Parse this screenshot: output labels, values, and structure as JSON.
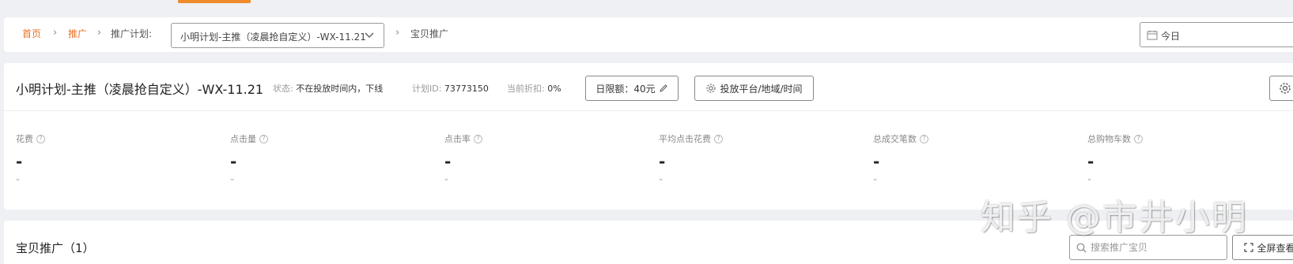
{
  "breadcrumb": {
    "home": "首页",
    "promote": "推广",
    "plan_label": "推广计划:",
    "plan_select_value": "小明计划-主推（凌晨抢自定义）-WX-11.21",
    "current": "宝贝推广"
  },
  "date_filter": {
    "value": "今日"
  },
  "plan": {
    "title": "小明计划-主推（凌晨抢自定义）-WX-11.21",
    "status_label": "状态:",
    "status_value": "不在投放时间内，下线",
    "id_label": "计划ID:",
    "id_value": "73773150",
    "discount_label": "当前折扣:",
    "discount_value": "0%",
    "budget_button": "日限额：40元",
    "platform_button": "投放平台/地域/时间"
  },
  "metrics": [
    {
      "label": "花费",
      "value": "-",
      "compare": "-"
    },
    {
      "label": "点击量",
      "value": "-",
      "compare": "-"
    },
    {
      "label": "点击率",
      "value": "-",
      "compare": "-"
    },
    {
      "label": "平均点击花费",
      "value": "-",
      "compare": "-"
    },
    {
      "label": "总成交笔数",
      "value": "-",
      "compare": "-"
    },
    {
      "label": "总购物车数",
      "value": "-",
      "compare": "-"
    }
  ],
  "items_section": {
    "title": "宝贝推广（1）",
    "search_placeholder": "搜索推广宝贝",
    "fullscreen_button": "全屏查看"
  },
  "watermark": "知乎 @市井小明",
  "colors": {
    "accent": "#e6702b",
    "background": "#eef0f3"
  }
}
